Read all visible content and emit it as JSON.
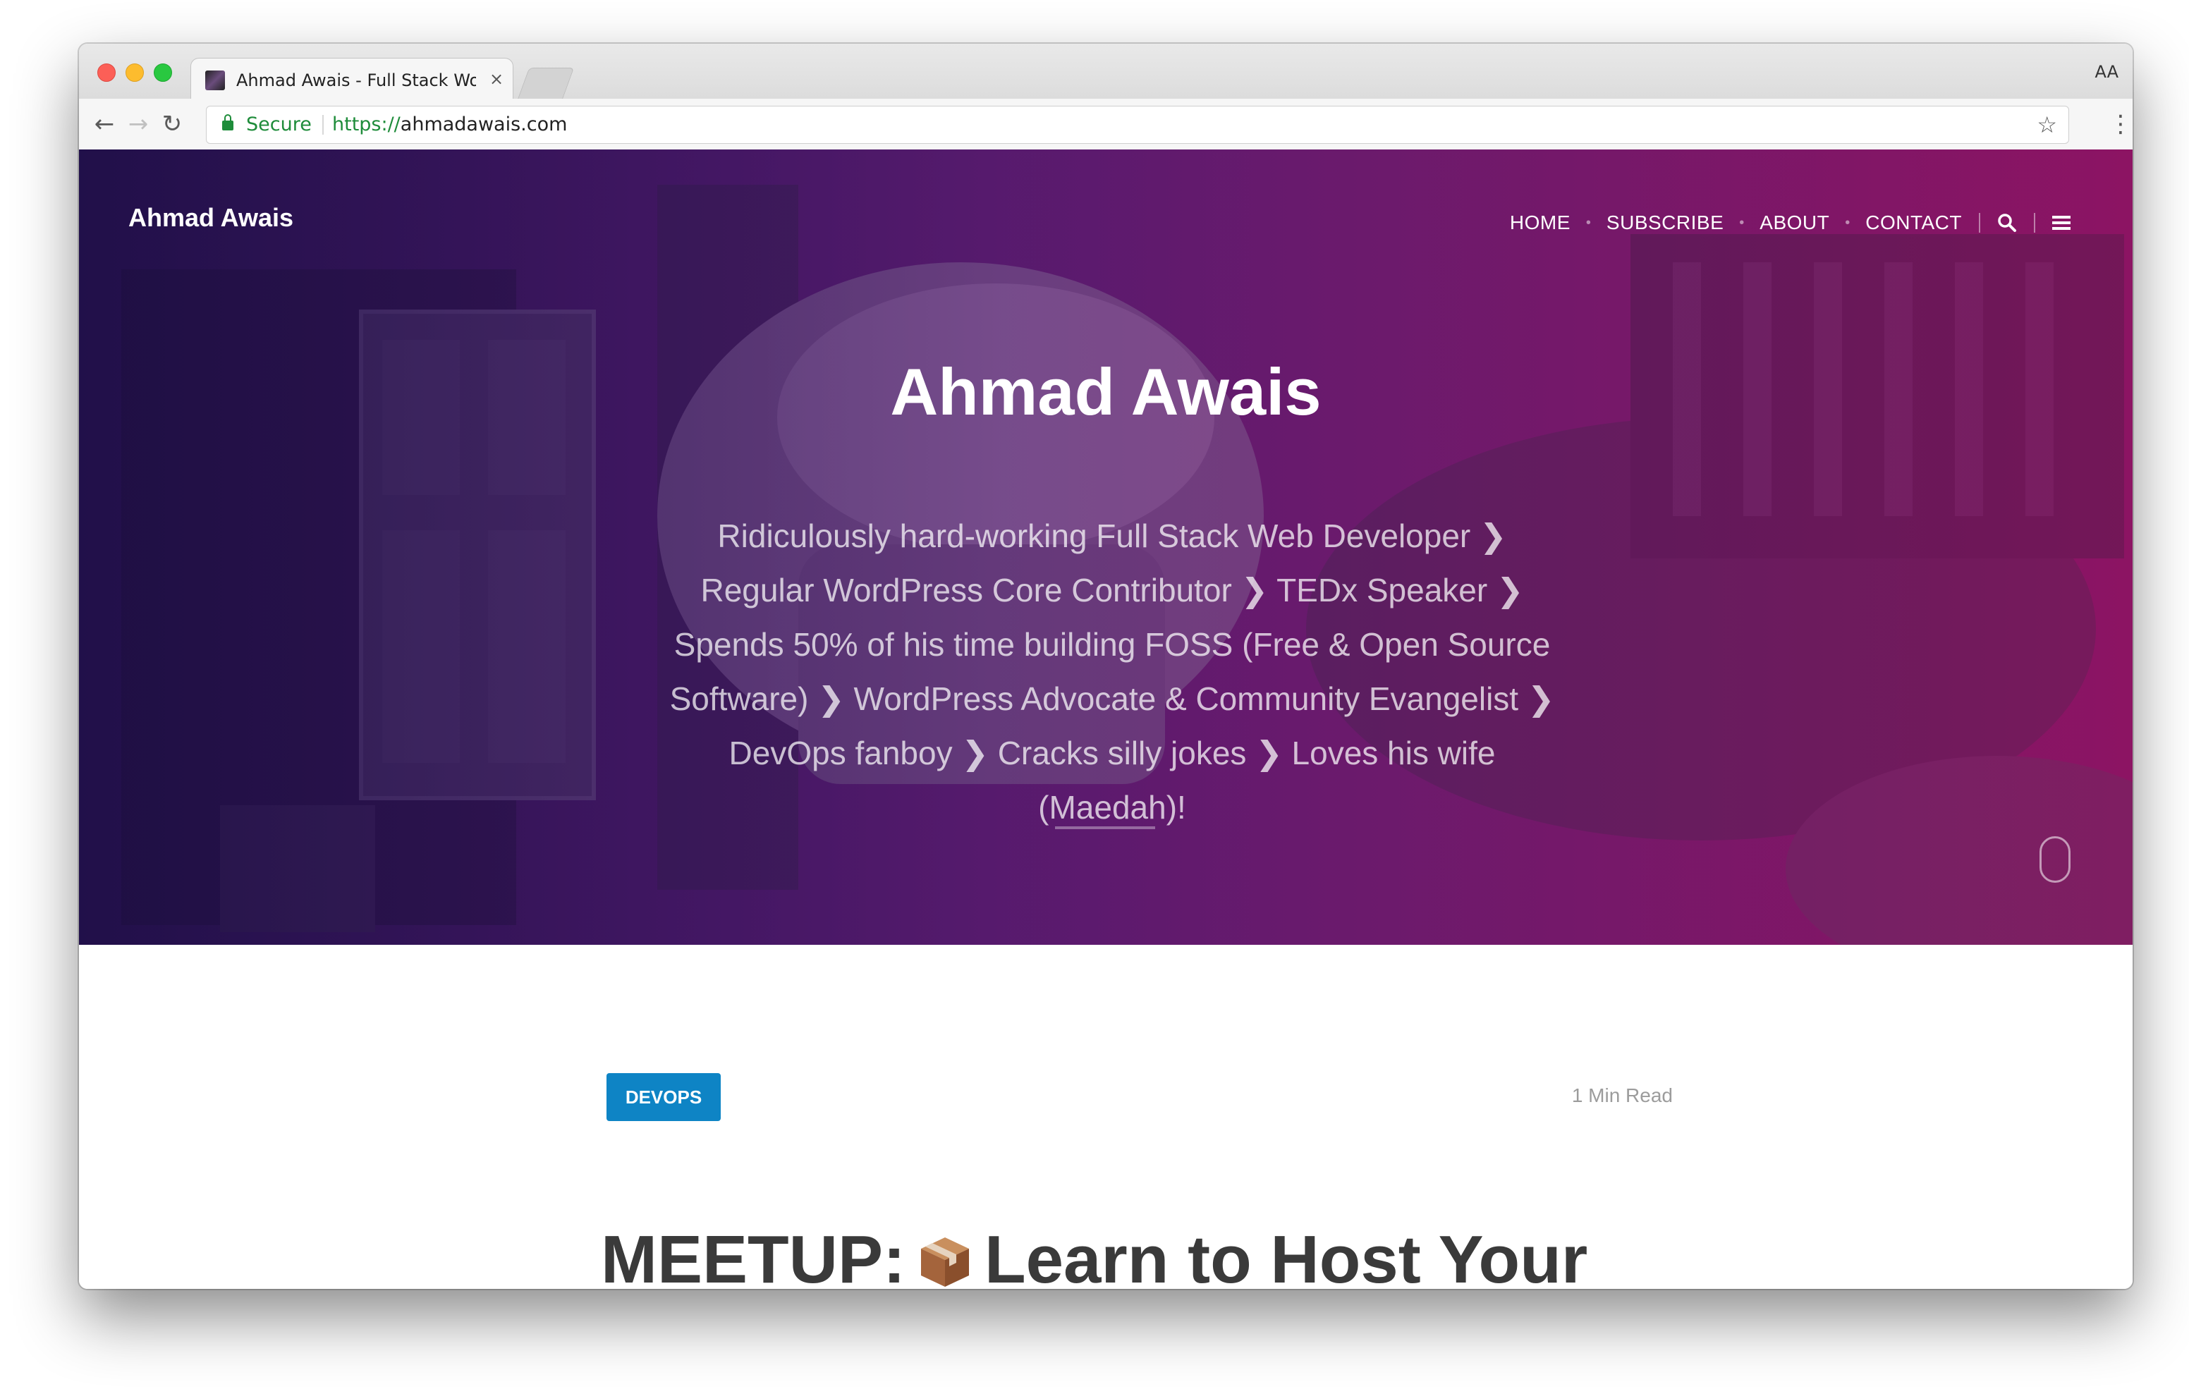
{
  "browser": {
    "tab_title": "Ahmad Awais - Full Stack Word",
    "tab_close": "×",
    "profile": "AA",
    "secure_label": "Secure",
    "url_scheme": "https://",
    "url_host": "ahmadawais.com",
    "back_icon": "←",
    "forward_icon": "→",
    "reload_icon": "↻",
    "star_icon": "☆",
    "menu_icon": "⋮"
  },
  "site": {
    "name": "Ahmad Awais",
    "nav": [
      "HOME",
      "SUBSCRIBE",
      "ABOUT",
      "CONTACT"
    ],
    "nav_dot": "•"
  },
  "hero": {
    "title": "Ahmad Awais",
    "tagline": "Ridiculously hard-working Full Stack Web Developer ❯ Regular WordPress Core Contributor ❯ TEDx Speaker ❯ Spends 50% of his time building FOSS (Free & Open Source Software) ❯ WordPress Advocate & Community Evangelist ❯ DevOps fanboy ❯ Cracks silly jokes ❯ Loves his wife (Maedah)!"
  },
  "post": {
    "category": "DEVOPS",
    "read_time": "1 Min Read",
    "title_prefix": "MEETUP:",
    "title_rest": "Learn to Host Your"
  },
  "colors": {
    "accent": "#0e84c5",
    "secure": "#1e8c3a",
    "hero_left": "#2a1654",
    "hero_right": "#8c1462"
  }
}
